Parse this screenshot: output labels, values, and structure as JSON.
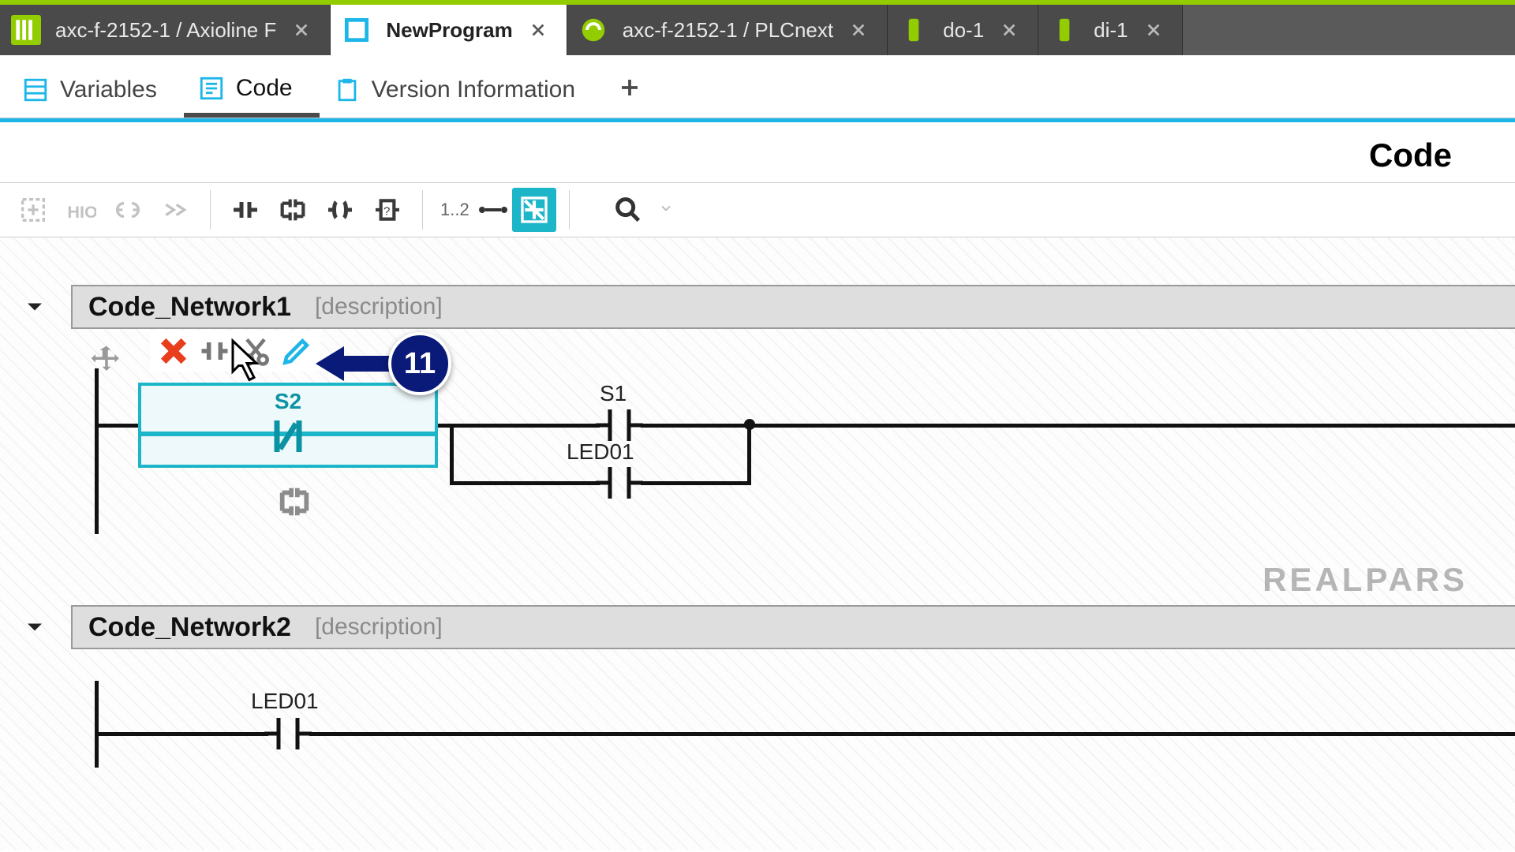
{
  "window_tabs": [
    {
      "label": "axc-f-2152-1 / Axioline F",
      "icon": "axioline",
      "accent": "#93cc00",
      "active": false
    },
    {
      "label": "NewProgram",
      "icon": "program",
      "accent": "#1db6e8",
      "active": true
    },
    {
      "label": "axc-f-2152-1 / PLCnext",
      "icon": "plcnext",
      "accent": "#93cc00",
      "active": false
    },
    {
      "label": "do-1",
      "icon": "io",
      "accent": "#93cc00",
      "active": false
    },
    {
      "label": "di-1",
      "icon": "io",
      "accent": "#93cc00",
      "active": false
    }
  ],
  "sub_tabs": {
    "items": [
      {
        "label": "Variables",
        "icon": "table",
        "active": false
      },
      {
        "label": "Code",
        "icon": "code",
        "active": true
      },
      {
        "label": "Version Information",
        "icon": "clipboard",
        "active": false
      }
    ]
  },
  "page_title": "Code",
  "toolbar": {
    "numbering": "1..2"
  },
  "networks": [
    {
      "title": "Code_Network1",
      "desc_placeholder": "[description]",
      "s2_label": "S2",
      "s1_label": "S1",
      "led_label": "LED01"
    },
    {
      "title": "Code_Network2",
      "desc_placeholder": "[description]",
      "led_label": "LED01"
    }
  ],
  "callout": {
    "number": "11"
  },
  "watermark": "REALPARS"
}
